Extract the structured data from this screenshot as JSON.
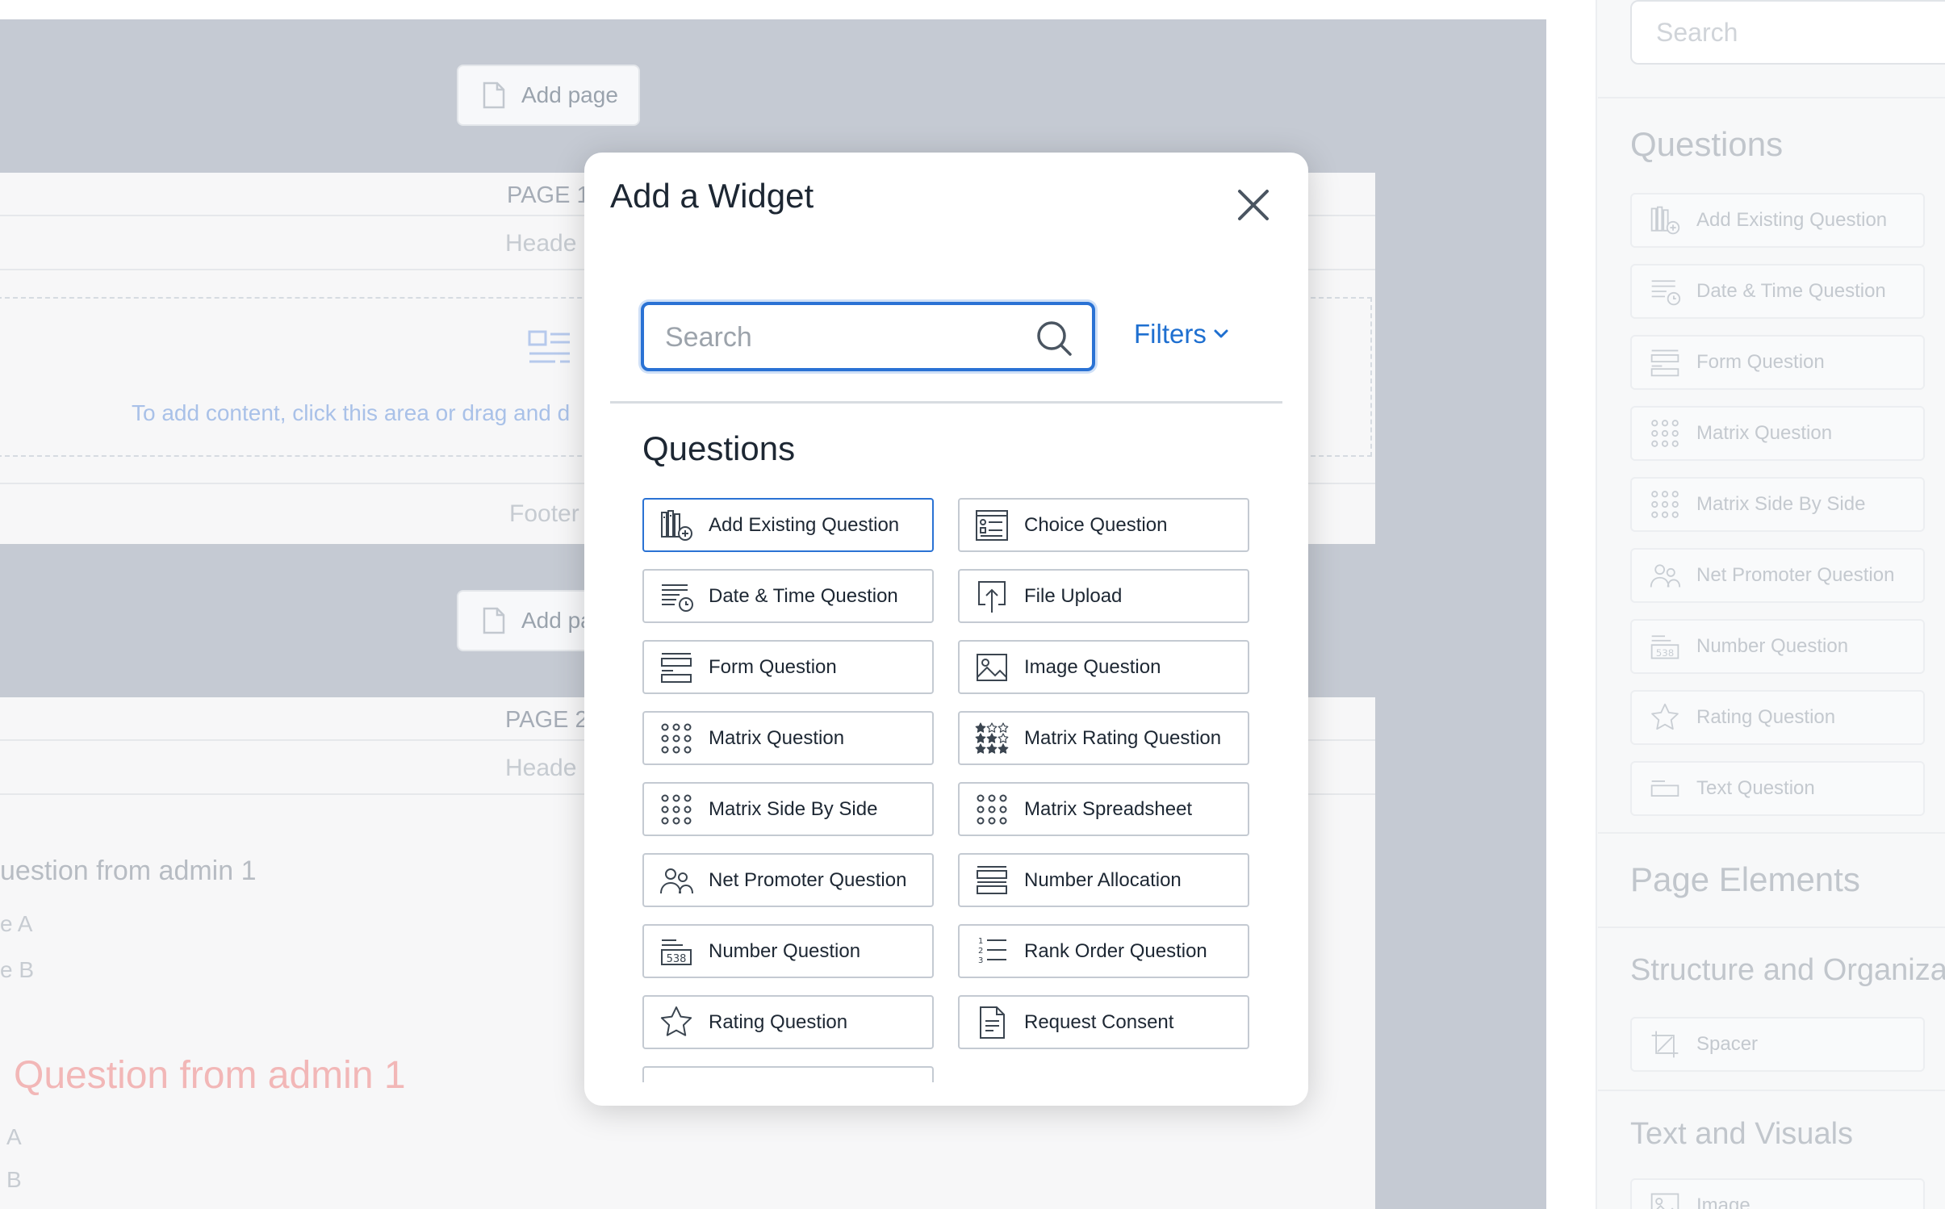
{
  "builder": {
    "add_page_label": "Add page",
    "add_page_label_partial": "Add pa",
    "page1_label": "PAGE 1",
    "page2_label": "PAGE 2",
    "header_label": "Heade",
    "footer_label": "Footer",
    "drop_hint": "To add content, click this area or drag and d",
    "question1_title": "uestion from admin 1",
    "question1_choice_a": "e A",
    "question1_choice_b": "e B",
    "question2_title": "Question from admin 1",
    "question2_choice_a": "A",
    "question2_choice_b": "B"
  },
  "sidebar": {
    "search_placeholder": "Search",
    "questions_heading": "Questions",
    "items": [
      {
        "label": "Add Existing Question",
        "icon": "add-existing-icon"
      },
      {
        "label": "Date & Time Question",
        "icon": "date-time-icon"
      },
      {
        "label": "Form Question",
        "icon": "form-icon"
      },
      {
        "label": "Matrix Question",
        "icon": "matrix-icon"
      },
      {
        "label": "Matrix Side By Side",
        "icon": "matrix-icon"
      },
      {
        "label": "Net Promoter Question",
        "icon": "people-icon"
      },
      {
        "label": "Number Question",
        "icon": "number-icon"
      },
      {
        "label": "Rating Question",
        "icon": "star-icon"
      },
      {
        "label": "Text Question",
        "icon": "text-icon"
      }
    ],
    "page_elements_heading": "Page Elements",
    "structure_heading": "Structure and Organizat",
    "spacer_label": "Spacer",
    "text_visuals_heading": "Text and Visuals",
    "image_label": "Image"
  },
  "modal": {
    "title": "Add a Widget",
    "search_placeholder": "Search",
    "filters_label": "Filters",
    "section_title": "Questions",
    "widgets": [
      {
        "label": "Add Existing Question",
        "icon": "add-existing-icon"
      },
      {
        "label": "Choice Question",
        "icon": "choice-icon"
      },
      {
        "label": "Date & Time Question",
        "icon": "date-time-icon"
      },
      {
        "label": "File Upload",
        "icon": "upload-icon"
      },
      {
        "label": "Form Question",
        "icon": "form-icon"
      },
      {
        "label": "Image Question",
        "icon": "image-icon"
      },
      {
        "label": "Matrix Question",
        "icon": "matrix-icon"
      },
      {
        "label": "Matrix Rating Question",
        "icon": "matrix-rating-icon"
      },
      {
        "label": "Matrix Side By Side",
        "icon": "matrix-icon"
      },
      {
        "label": "Matrix Spreadsheet",
        "icon": "matrix-icon"
      },
      {
        "label": "Net Promoter Question",
        "icon": "people-icon"
      },
      {
        "label": "Number Allocation",
        "icon": "allocation-icon"
      },
      {
        "label": "Number Question",
        "icon": "number-icon"
      },
      {
        "label": "Rank Order Question",
        "icon": "rank-order-icon"
      },
      {
        "label": "Rating Question",
        "icon": "star-icon"
      },
      {
        "label": "Request Consent",
        "icon": "consent-icon"
      }
    ]
  },
  "colors": {
    "accent": "#2a72d4",
    "link": "#1e6fd0",
    "overlay": "#c5cad3"
  }
}
